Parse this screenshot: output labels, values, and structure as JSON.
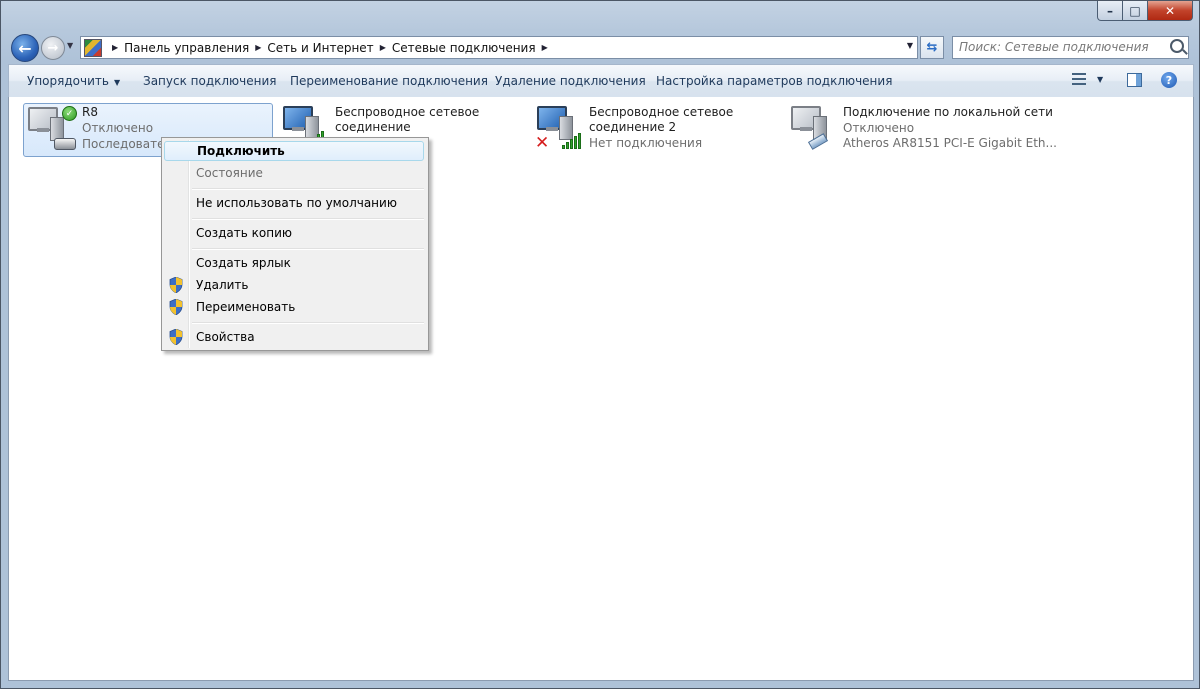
{
  "window": {
    "minimize_glyph": "–",
    "maximize_glyph": "□",
    "close_glyph": "✕"
  },
  "nav": {
    "back_glyph": "←",
    "forward_glyph": "→",
    "breadcrumbs": [
      "Панель управления",
      "Сеть и Интернет",
      "Сетевые подключения"
    ],
    "search_placeholder": "Поиск: Сетевые подключения"
  },
  "toolbar": {
    "organize": "Упорядочить",
    "start": "Запуск подключения",
    "rename": "Переименование подключения",
    "delete": "Удаление подключения",
    "settings": "Настройка параметров подключения",
    "help": "?"
  },
  "connections": [
    {
      "name": "R8",
      "status": "Отключено",
      "device": "Последовател",
      "icon": "modem-connection-icon",
      "selected": true
    },
    {
      "name_line1": "Беспроводное сетевое",
      "name_line2": "соединение",
      "icon": "wireless-connection-icon"
    },
    {
      "name_line1": "Беспроводное сетевое",
      "name_line2": "соединение 2",
      "status": "Нет подключения",
      "icon": "wireless-connection-icon",
      "error": true
    },
    {
      "name": "Подключение по локальной сети",
      "status": "Отключено",
      "device": "Atheros AR8151 PCI-E Gigabit Eth...",
      "icon": "lan-connection-icon"
    }
  ],
  "context_menu": {
    "connect": "Подключить",
    "status": "Состояние",
    "not_default": "Не использовать по умолчанию",
    "copy": "Создать копию",
    "shortcut": "Создать ярлык",
    "delete": "Удалить",
    "rename": "Переименовать",
    "properties": "Свойства"
  },
  "colors": {
    "accent": "#1e395b",
    "selection": "#d7e8fb",
    "error": "#d51d1d",
    "signal": "#2ea32a"
  }
}
